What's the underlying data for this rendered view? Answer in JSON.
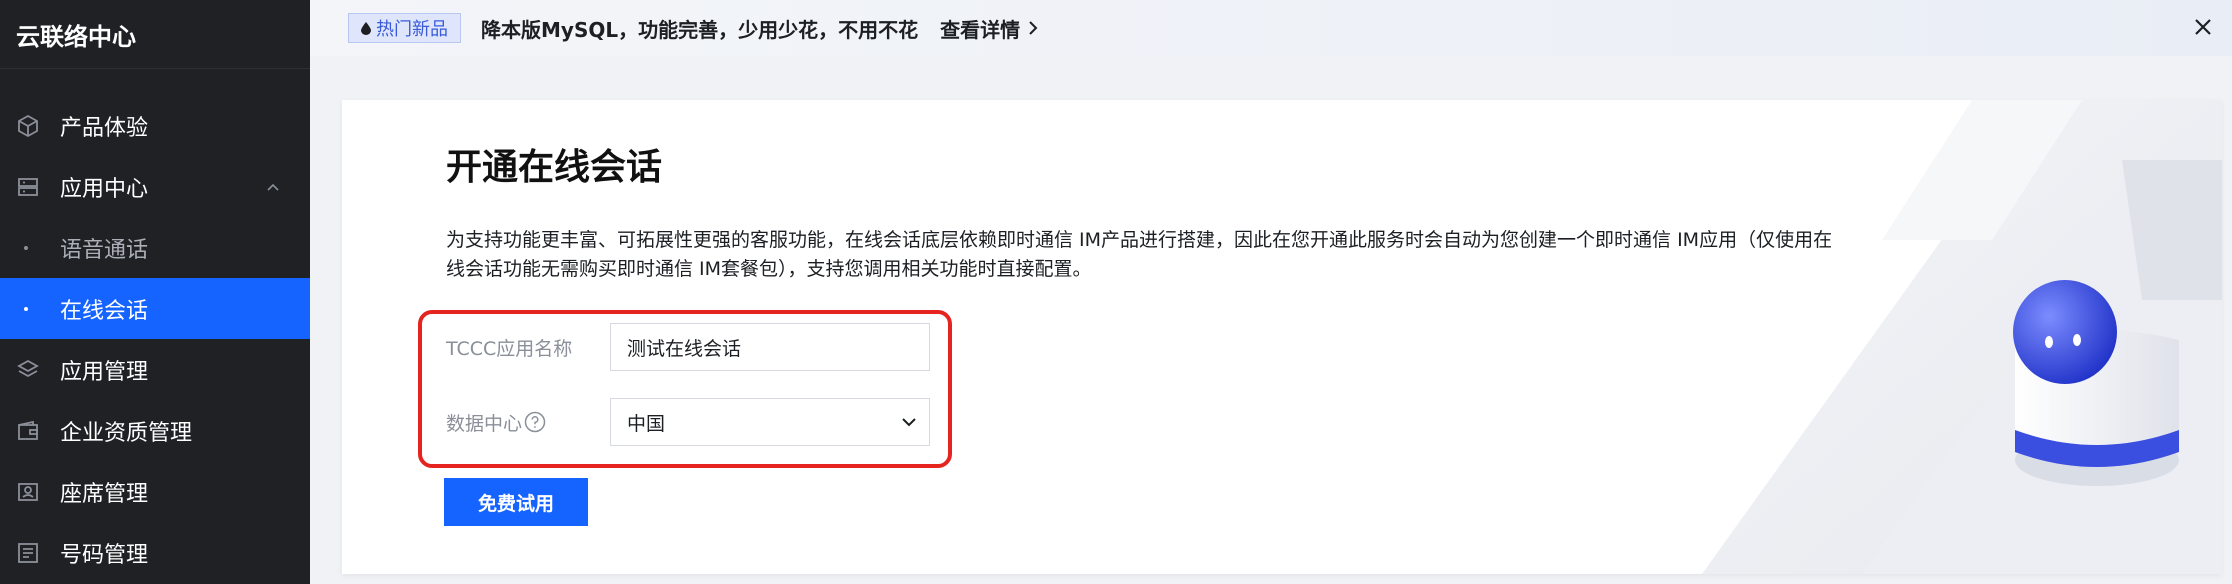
{
  "sidebar": {
    "brand": "云联络中心",
    "items": [
      {
        "label": "产品体验",
        "icon": "cube-icon"
      },
      {
        "label": "应用中心",
        "icon": "server-icon"
      },
      {
        "label": "语音通话"
      },
      {
        "label": "在线会话"
      },
      {
        "label": "应用管理",
        "icon": "layers-icon"
      },
      {
        "label": "企业资质管理",
        "icon": "wallet-icon"
      },
      {
        "label": "座席管理",
        "icon": "id-card-icon"
      },
      {
        "label": "号码管理",
        "icon": "list-icon"
      }
    ]
  },
  "banner": {
    "tag": "热门新品",
    "text": "降本版MySQL，功能完善，少用少花，不用不花",
    "link": "查看详情"
  },
  "main": {
    "title": "开通在线会话",
    "description": "为支持功能更丰富、可拓展性更强的客服功能，在线会话底层依赖即时通信 IM产品进行搭建，因此在您开通此服务时会自动为您创建一个即时通信 IM应用（仅使用在线会话功能无需购买即时通信 IM套餐包），支持您调用相关功能时直接配置。",
    "form": {
      "app_name_label": "TCCC应用名称",
      "app_name_value": "测试在线会话",
      "datacenter_label": "数据中心",
      "datacenter_value": "中国"
    },
    "submit": "免费试用"
  },
  "colors": {
    "primary": "#1664ff",
    "sidebar_bg": "#1f2125",
    "highlight_border": "#e5241f"
  }
}
